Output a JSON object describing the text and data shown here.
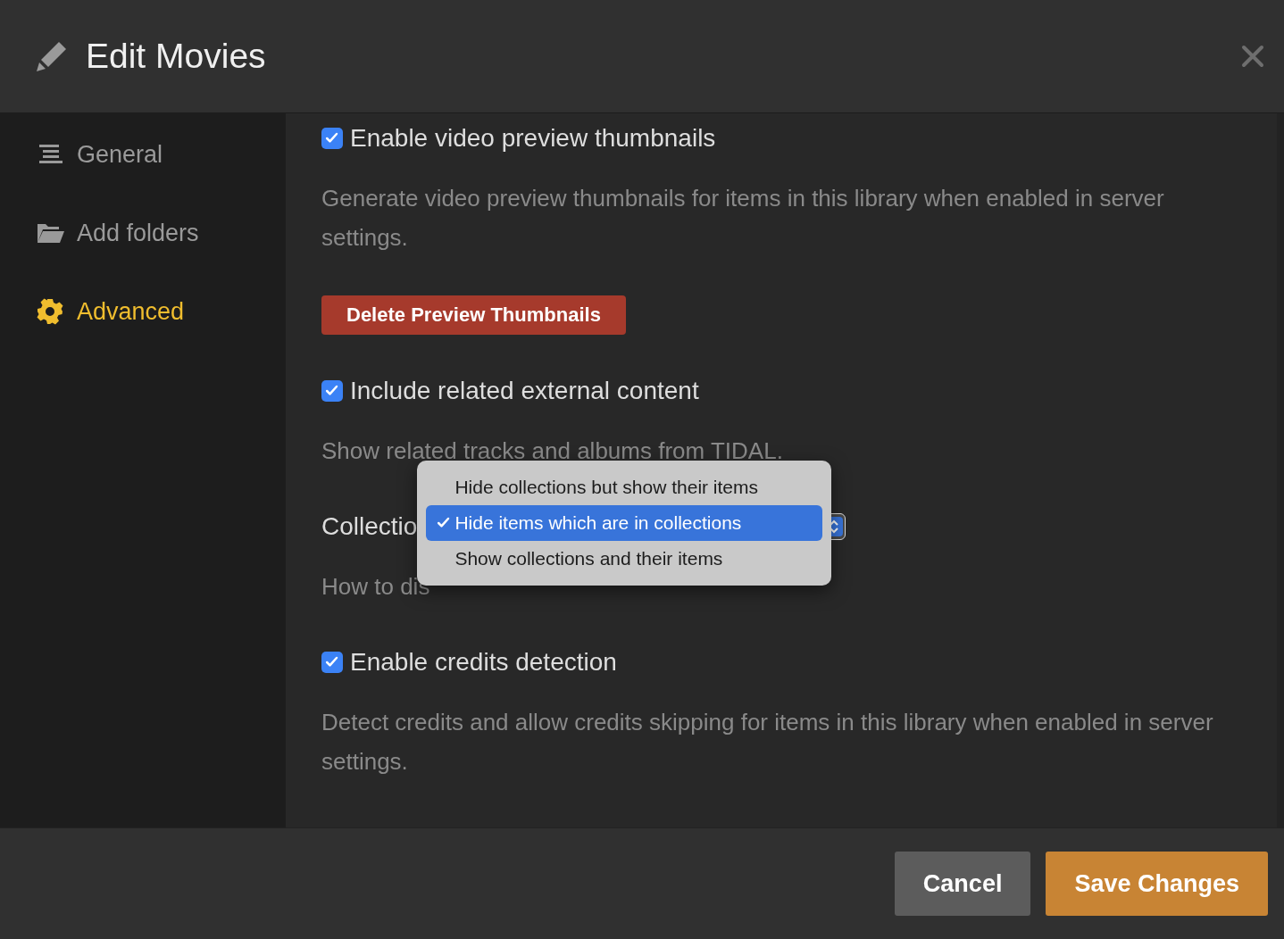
{
  "dialog": {
    "title": "Edit Movies"
  },
  "sidebar": {
    "items": [
      {
        "label": "General",
        "selected": false
      },
      {
        "label": "Add folders",
        "selected": false
      },
      {
        "label": "Advanced",
        "selected": true
      }
    ]
  },
  "settings": [
    {
      "kind": "checkbox",
      "label": "Enable video preview thumbnails",
      "checked": true,
      "description": "Generate video preview thumbnails for items in this library when enabled in server settings."
    },
    {
      "kind": "button",
      "label": "Delete Preview Thumbnails"
    },
    {
      "kind": "checkbox",
      "label": "Include related external content",
      "checked": true,
      "description": "Show related tracks and albums from TIDAL."
    },
    {
      "kind": "select",
      "label": "Collectio",
      "description": "How to dis",
      "options": [
        {
          "label": "Hide collections but show their items",
          "selected": false
        },
        {
          "label": "Hide items which are in collections",
          "selected": true
        },
        {
          "label": "Show collections and their items",
          "selected": false
        }
      ]
    },
    {
      "kind": "checkbox",
      "label": "Enable credits detection",
      "checked": true,
      "description": "Detect credits and allow credits skipping for items in this library when enabled in server settings."
    }
  ],
  "footer": {
    "buttons": [
      {
        "label": "Cancel",
        "kind": "secondary"
      },
      {
        "label": "Save Changes",
        "kind": "primary"
      }
    ]
  }
}
